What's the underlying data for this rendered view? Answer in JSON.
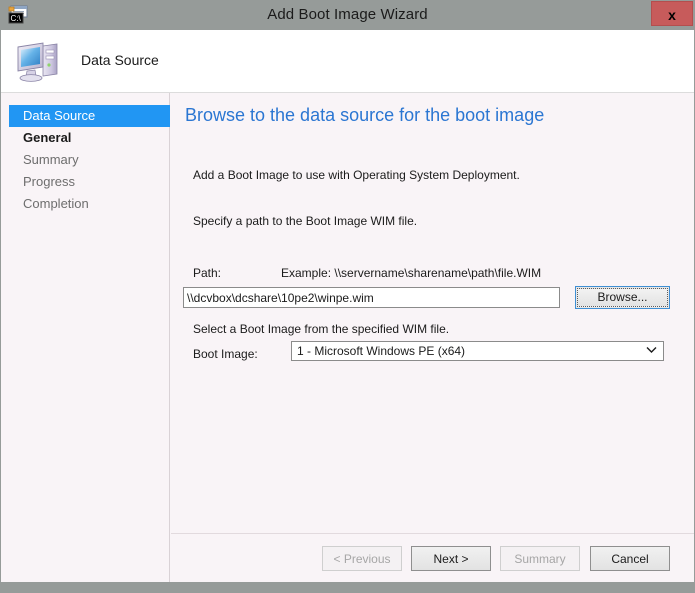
{
  "window": {
    "title": "Add Boot Image Wizard",
    "app_icon": "console-window-icon",
    "close_label": "x"
  },
  "header": {
    "icon": "computer-icon",
    "title": "Data Source"
  },
  "sidebar": {
    "items": [
      {
        "label": "Data Source",
        "state": "active"
      },
      {
        "label": "General",
        "state": "done"
      },
      {
        "label": "Summary",
        "state": "pending"
      },
      {
        "label": "Progress",
        "state": "pending"
      },
      {
        "label": "Completion",
        "state": "pending"
      }
    ]
  },
  "content": {
    "heading": "Browse to the data source for the boot image",
    "paragraph_1": "Add a Boot Image to use with Operating System Deployment.",
    "paragraph_2": "Specify a path to the Boot Image WIM file.",
    "path_label": "Path:",
    "path_example": "Example: \\\\servername\\sharename\\path\\file.WIM",
    "path_value": "\\\\dcvbox\\dcshare\\10pe2\\winpe.wim",
    "path_placeholder": "",
    "browse_label": "Browse...",
    "select_hint": "Select a Boot Image from the specified WIM file.",
    "boot_image_label": "Boot Image:",
    "boot_image_value": "1 - Microsoft Windows PE (x64)",
    "boot_image_arrow": "⌄"
  },
  "footer": {
    "previous_label": "< Previous",
    "next_label": "Next >",
    "summary_label": "Summary",
    "cancel_label": "Cancel"
  },
  "colors": {
    "titlebar": "#969b99",
    "close_button": "#c75b5b",
    "accent_heading": "#2b76d2",
    "nav_active": "#2196f3",
    "content_background": "#f9f4f7"
  }
}
